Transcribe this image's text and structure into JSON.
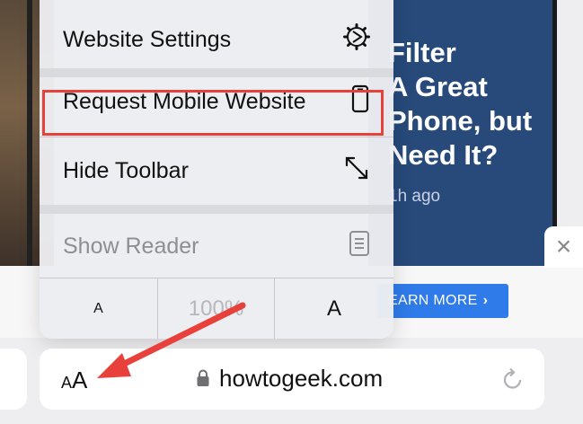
{
  "background": {
    "article_title": "Filter\nA Great\nPhone, but\nNeed It?",
    "article_time": "1h ago",
    "ad": {
      "learn_more_label": "EARN MORE",
      "learn_more_chevron": "›",
      "close_glyph": "×"
    }
  },
  "menu": {
    "items": [
      {
        "label": "Website Settings",
        "icon": "gear-icon"
      },
      {
        "label": "Request Mobile Website",
        "icon": "phone-icon"
      },
      {
        "label": "Hide Toolbar",
        "icon": "expand-arrows-icon"
      },
      {
        "label": "Show Reader",
        "icon": "reader-icon"
      }
    ],
    "zoom": {
      "decrease_label": "A",
      "percent": "100%",
      "increase_label": "A"
    }
  },
  "address_bar": {
    "aa_small": "A",
    "aa_large": "A",
    "domain": "howtogeek.com"
  },
  "annotation": {
    "highlight_color": "#e8413c",
    "arrow_color": "#e8413c"
  }
}
